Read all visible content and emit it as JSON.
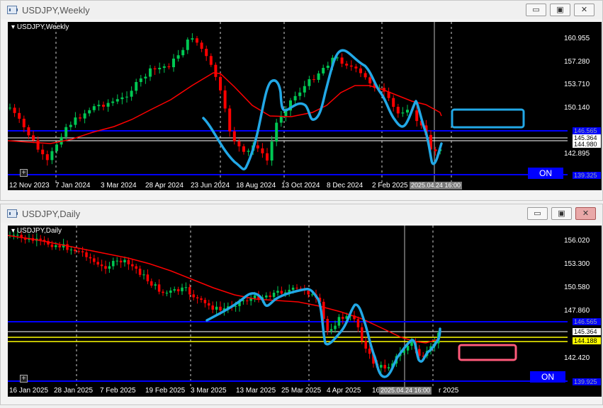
{
  "weekly": {
    "window_title": "USDJPY,Weekly",
    "symbol_label": "USDJPY,Weekly",
    "price_ticks": [
      "160.955",
      "157.280",
      "153.710",
      "150.140",
      "146.565",
      "145.364",
      "144.980",
      "142.895",
      "139.325"
    ],
    "date_ticks": [
      "12 Nov 2023",
      "7 Jan 2024",
      "3 Mar 2024",
      "28 Apr 2024",
      "23 Jun 2024",
      "18 Aug 2024",
      "13 Oct 2024",
      "8 Dec 2024",
      "2 Feb 2025",
      "2025.04.24 16:00"
    ],
    "on_label": "ON",
    "buttons": {
      "minimize": "▭",
      "restore": "▣",
      "close": "✕"
    }
  },
  "daily": {
    "window_title": "USDJPY,Daily",
    "symbol_label": "USDJPY,Daily",
    "price_ticks": [
      "156.020",
      "153.300",
      "150.580",
      "147.860",
      "146.565",
      "145.364",
      "144.188",
      "142.420",
      "139.925"
    ],
    "date_ticks": [
      "16 Jan 2025",
      "28 Jan 2025",
      "7 Feb 2025",
      "19 Feb 2025",
      "3 Mar 2025",
      "13 Mar 2025",
      "25 Mar 2025",
      "4 Apr 2025",
      "16",
      "2025.04.24 16:00",
      "r 2025"
    ],
    "on_label": "ON",
    "buttons": {
      "minimize": "▭",
      "restore": "▣",
      "close": "✕"
    }
  },
  "colors": {
    "background": "#000000",
    "bull_candle": "#00c853",
    "bear_candle": "#ff0000",
    "moving_average": "#ff0000",
    "drawing": "#22a8e6",
    "level_line": "#0000ff",
    "yellow_level": "#ffff00",
    "pink_box": "#ff5a7a",
    "on_button": "#0000ff"
  }
}
